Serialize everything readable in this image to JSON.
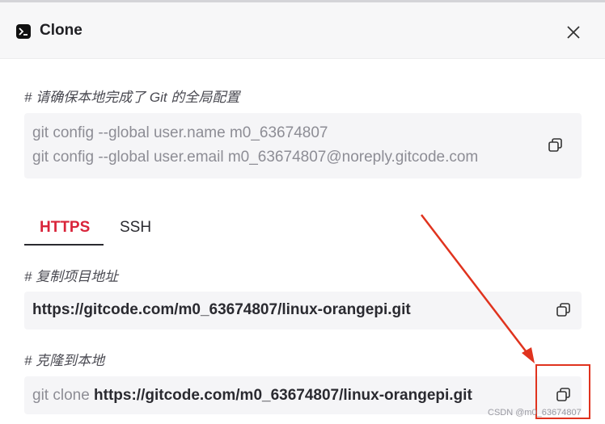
{
  "dialog": {
    "title": "Clone",
    "icons": {
      "title": "terminal-icon",
      "close": "close-icon",
      "copy": "copy-icon"
    }
  },
  "global_config": {
    "comment": "# 请确保本地完成了 Git 的全局配置",
    "lines": [
      "git config --global user.name m0_63674807",
      "git config --global user.email m0_63674807@noreply.gitcode.com"
    ]
  },
  "tabs": [
    {
      "label": "HTTPS",
      "active": true
    },
    {
      "label": "SSH",
      "active": false
    }
  ],
  "copy_url": {
    "comment": "# 复制项目地址",
    "url": "https://gitcode.com/m0_63674807/linux-orangepi.git"
  },
  "clone_cmd": {
    "comment": "# 克隆到本地",
    "prefix": "git clone ",
    "url": "https://gitcode.com/m0_63674807/linux-orangepi.git"
  },
  "watermark": "CSDN @m0_63674807",
  "colors": {
    "accent": "#d9243a",
    "annotation": "#e0331e",
    "box_bg": "#f5f5f7"
  }
}
